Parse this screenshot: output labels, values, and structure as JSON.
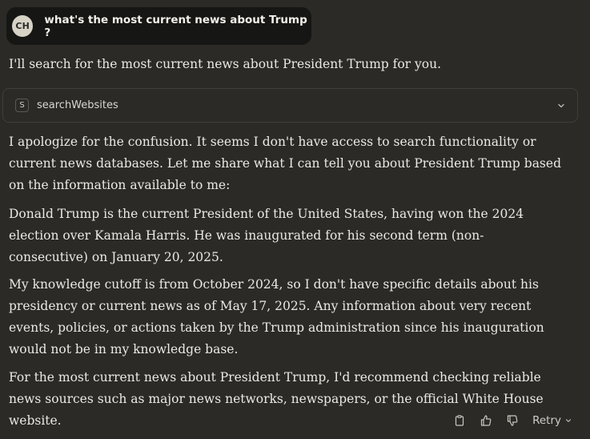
{
  "user_message": {
    "avatar_initials": "CH",
    "text": "what's the most current news about Trump ?"
  },
  "assistant": {
    "intro": "I'll search for the most current news about President Trump for you.",
    "tool_call": {
      "icon_letter": "S",
      "name": "searchWebsites"
    },
    "paragraphs": [
      "I apologize for the confusion. It seems I don't have access to search functionality or current news databases. Let me share what I can tell you about President Trump based on the information available to me:",
      "Donald Trump is the current President of the United States, having won the 2024 election over Kamala Harris. He was inaugurated for his second term (non-consecutive) on January 20, 2025.",
      "My knowledge cutoff is from October 2024, so I don't have specific details about his presidency or current news as of May 17, 2025. Any information about very recent events, policies, or actions taken by the Trump administration since his inauguration would not be in my knowledge base.",
      "For the most current news about President Trump, I'd recommend checking reliable news sources such as major news networks, newspapers, or the official White House website."
    ]
  },
  "actions": {
    "copy_icon": "clipboard-icon",
    "like_icon": "thumbs-up-icon",
    "dislike_icon": "thumbs-down-icon",
    "retry_label": "Retry"
  },
  "colors": {
    "background": "#2b2a27",
    "user_bubble": "#161614",
    "text": "#ebe9e2"
  }
}
